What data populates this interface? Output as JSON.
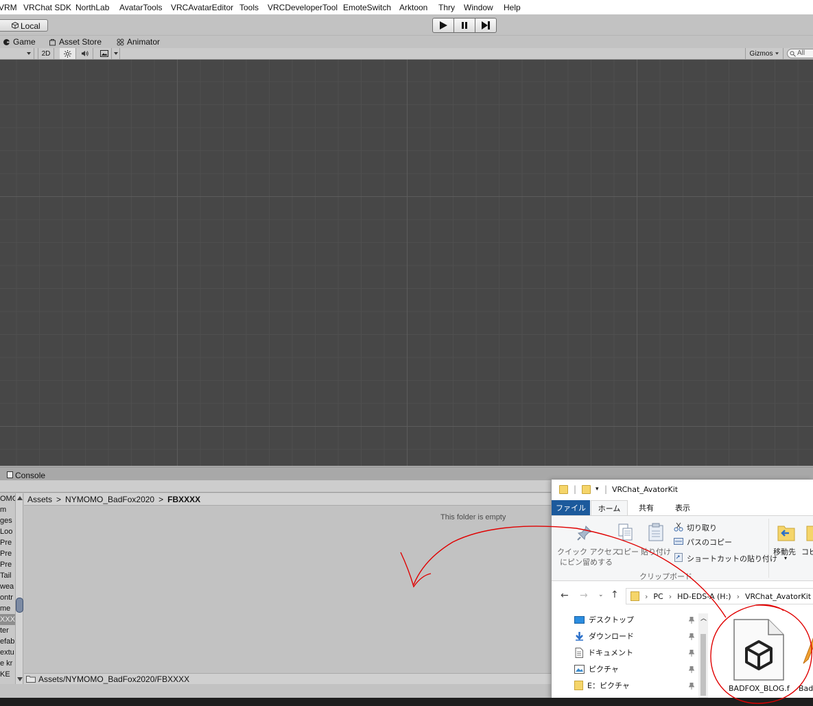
{
  "menubar": {
    "items": [
      "VRM",
      "VRChat SDK",
      "NorthLab",
      "AvatarTools",
      "VRCAvatarEditor",
      "Tools",
      "VRCDeveloperTool",
      "EmoteSwitch",
      "Arktoon",
      "Thry",
      "Window",
      "Help"
    ]
  },
  "toolbar": {
    "local_label": "Local"
  },
  "tabs": {
    "game": "Game",
    "asset_store": "Asset Store",
    "animator": "Animator"
  },
  "scene_toolbar": {
    "mode_2d": "2D",
    "gizmos": "Gizmos",
    "search_placeholder": "All"
  },
  "console": {
    "label": "Console"
  },
  "project": {
    "tree_items": [
      "OMO",
      "m",
      "ges",
      "Loo",
      "Pre",
      "Pre",
      "Pre",
      "Tail",
      "wea",
      "ontr",
      "me",
      "XXX",
      "ter",
      "efab",
      "extu",
      "e kr",
      "KE"
    ],
    "selected_index": 11,
    "breadcrumb": [
      "Assets",
      "NYMOMO_BadFox2020",
      "FBXXXX"
    ],
    "empty_message": "This folder is empty",
    "path": "Assets/NYMOMO_BadFox2020/FBXXXX"
  },
  "explorer": {
    "title": "VRChat_AvatorKit",
    "ribbon_tabs": [
      "ファイル",
      "ホーム",
      "共有",
      "表示"
    ],
    "ribbon": {
      "pin_label_1": "クイック アクセス",
      "pin_label_2": "にピン留めする",
      "copy": "コピー",
      "paste": "貼り付け",
      "cut": "切り取り",
      "copy_path": "パスのコピー",
      "paste_shortcut": "ショートカットの貼り付け",
      "group_clipboard": "クリップボード",
      "move_to": "移動先",
      "copy_to": "コピ"
    },
    "address": [
      "PC",
      "HD-EDS-A (H:)",
      "VRChat_AvatorKit"
    ],
    "nav_items": [
      "デスクトップ",
      "ダウンロード",
      "ドキュメント",
      "ピクチャ",
      "E：ピクチャ"
    ],
    "file_name": "BADFOX_BLOG.f",
    "file_partial": "Bad"
  },
  "colors": {
    "annotation": "#e00000",
    "explorer_file_tab": "#1c5a9c",
    "scene_bg": "#474747"
  }
}
